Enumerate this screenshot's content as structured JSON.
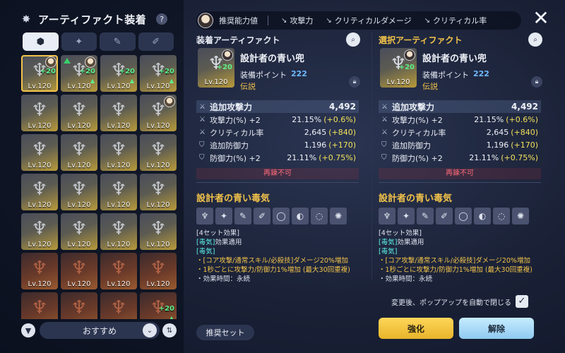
{
  "header": {
    "title": "アーティファクト装着",
    "help": "?"
  },
  "category_tabs": [
    {
      "icon": "artifact-icon",
      "glyph": "⬢"
    },
    {
      "icon": "armor-icon",
      "glyph": "✦"
    },
    {
      "icon": "weapon-icon",
      "glyph": "✎"
    },
    {
      "icon": "tool-icon",
      "glyph": "✐"
    }
  ],
  "inventory": [
    {
      "lv": "Lv.120",
      "tint": "gold",
      "plus": "+20",
      "selected": true,
      "avatar": true,
      "up": false,
      "green_arrow": false
    },
    {
      "lv": "Lv.120",
      "tint": "gold",
      "plus": "+20",
      "selected": false,
      "avatar": true,
      "up": true,
      "green_arrow": true
    },
    {
      "lv": "Lv.120",
      "tint": "gold",
      "plus": "+20",
      "selected": false,
      "avatar": false,
      "up": true,
      "green_arrow": false
    },
    {
      "lv": "Lv.120",
      "tint": "gold",
      "plus": "+20",
      "selected": false,
      "avatar": false,
      "up": true,
      "green_arrow": false
    },
    {
      "lv": "Lv.120",
      "tint": "gold",
      "plus": "",
      "selected": false,
      "avatar": false,
      "up": false,
      "green_arrow": false
    },
    {
      "lv": "Lv.120",
      "tint": "gold",
      "plus": "",
      "selected": false,
      "avatar": false,
      "up": false,
      "green_arrow": false
    },
    {
      "lv": "Lv.120",
      "tint": "gold",
      "plus": "",
      "selected": false,
      "avatar": false,
      "up": false,
      "green_arrow": false
    },
    {
      "lv": "Lv.120",
      "tint": "gold",
      "plus": "",
      "selected": false,
      "avatar": true,
      "up": false,
      "green_arrow": false
    },
    {
      "lv": "Lv.120",
      "tint": "gold",
      "plus": "",
      "selected": false,
      "avatar": false,
      "up": false,
      "green_arrow": false
    },
    {
      "lv": "Lv.120",
      "tint": "gold",
      "plus": "",
      "selected": false,
      "avatar": false,
      "up": false,
      "green_arrow": false
    },
    {
      "lv": "Lv.120",
      "tint": "gold",
      "plus": "",
      "selected": false,
      "avatar": false,
      "up": false,
      "green_arrow": false
    },
    {
      "lv": "Lv.120",
      "tint": "gold",
      "plus": "",
      "selected": false,
      "avatar": false,
      "up": false,
      "green_arrow": false
    },
    {
      "lv": "Lv.120",
      "tint": "gold",
      "plus": "",
      "selected": false,
      "avatar": false,
      "up": false,
      "green_arrow": false
    },
    {
      "lv": "Lv.120",
      "tint": "gold",
      "plus": "",
      "selected": false,
      "avatar": false,
      "up": false,
      "green_arrow": false
    },
    {
      "lv": "Lv.120",
      "tint": "gold",
      "plus": "",
      "selected": false,
      "avatar": false,
      "up": false,
      "green_arrow": false
    },
    {
      "lv": "Lv.120",
      "tint": "gold",
      "plus": "",
      "selected": false,
      "avatar": false,
      "up": false,
      "green_arrow": false
    },
    {
      "lv": "Lv.120",
      "tint": "gold",
      "plus": "",
      "selected": false,
      "avatar": false,
      "up": false,
      "green_arrow": false
    },
    {
      "lv": "Lv.120",
      "tint": "gold",
      "plus": "",
      "selected": false,
      "avatar": false,
      "up": false,
      "green_arrow": false
    },
    {
      "lv": "Lv.120",
      "tint": "gold",
      "plus": "",
      "selected": false,
      "avatar": false,
      "up": false,
      "green_arrow": false
    },
    {
      "lv": "Lv.120",
      "tint": "gold",
      "plus": "",
      "selected": false,
      "avatar": false,
      "up": false,
      "green_arrow": false
    },
    {
      "lv": "Lv.120",
      "tint": "red",
      "plus": "",
      "selected": false,
      "avatar": false,
      "up": false,
      "green_arrow": false
    },
    {
      "lv": "Lv.120",
      "tint": "red",
      "plus": "",
      "selected": false,
      "avatar": false,
      "up": false,
      "green_arrow": false
    },
    {
      "lv": "Lv.120",
      "tint": "red",
      "plus": "",
      "selected": false,
      "avatar": false,
      "up": false,
      "green_arrow": false
    },
    {
      "lv": "Lv.120",
      "tint": "red",
      "plus": "",
      "selected": false,
      "avatar": false,
      "up": false,
      "green_arrow": false
    },
    {
      "lv": "Lv.120",
      "tint": "red",
      "plus": "",
      "selected": false,
      "avatar": false,
      "up": false,
      "green_arrow": false
    },
    {
      "lv": "Lv.120",
      "tint": "red",
      "plus": "",
      "selected": false,
      "avatar": false,
      "up": false,
      "green_arrow": false
    },
    {
      "lv": "Lv.120",
      "tint": "red",
      "plus": "",
      "selected": false,
      "avatar": false,
      "up": false,
      "green_arrow": false
    },
    {
      "lv": "Lv.120",
      "tint": "red",
      "plus": "+20",
      "selected": false,
      "avatar": false,
      "up": true,
      "green_arrow": false
    },
    {
      "lv": "Lv.120",
      "tint": "red",
      "plus": "",
      "selected": false,
      "avatar": true,
      "up": false,
      "green_arrow": false
    },
    {
      "lv": "Lv.120",
      "tint": "red",
      "plus": "+20",
      "selected": false,
      "avatar": true,
      "up": false,
      "green_arrow": true
    },
    {
      "lv": "Lv.120",
      "tint": "red",
      "plus": "",
      "selected": false,
      "avatar": true,
      "up": false,
      "green_arrow": false
    },
    {
      "lv": "Lv.120",
      "tint": "red",
      "plus": "",
      "selected": false,
      "avatar": true,
      "up": false,
      "green_arrow": false
    }
  ],
  "sort": {
    "label": "おすすめ"
  },
  "topbar": {
    "recommended": "推奨能力値",
    "stats": [
      "攻撃力",
      "クリティカルダメージ",
      "クリティカル率"
    ]
  },
  "equipped": {
    "panel_title": "装着アーティファクト",
    "name": "設計者の青い兜",
    "points_label": "装備ポイント",
    "points": "222",
    "grade": "伝説",
    "lv": "Lv.120",
    "plus": "+20",
    "main_stat": {
      "label": "追加攻撃力",
      "value": "4,492"
    },
    "sub_stats": [
      {
        "label": "攻撃力(%) +2",
        "value": "21.15%",
        "bonus": "(+0.6%)"
      },
      {
        "label": "クリティカル率",
        "value": "2,645",
        "bonus": "(+840)"
      },
      {
        "label": "追加防御力",
        "value": "1,196",
        "bonus": "(+170)"
      },
      {
        "label": "防御力(%) +2",
        "value": "21.11%",
        "bonus": "(+0.75%)"
      }
    ],
    "no_refine": "再錬不可",
    "set_title": "設計者の青い毒気",
    "set_desc": {
      "head": "[4セット効果]",
      "applied": "[毒気]",
      "applied_suffix": "効果適用",
      "effect_name": "[毒気]",
      "line1": "・[コア攻撃/通常スキル/必殺技]ダメージ20%増加",
      "line2": "・1秒ごとに攻撃力/防御力1%増加 (最大30回重複)",
      "line3": "・効果時間：永続"
    }
  },
  "selected": {
    "panel_title": "選択アーティファクト",
    "name": "設計者の青い兜",
    "points_label": "装備ポイント",
    "points": "222",
    "grade": "伝説",
    "lv": "Lv.120",
    "plus": "+20",
    "main_stat": {
      "label": "追加攻撃力",
      "value": "4,492"
    },
    "sub_stats": [
      {
        "label": "攻撃力(%) +2",
        "value": "21.15%",
        "bonus": "(+0.6%)"
      },
      {
        "label": "クリティカル率",
        "value": "2,645",
        "bonus": "(+840)"
      },
      {
        "label": "追加防御力",
        "value": "1,196",
        "bonus": "(+170)"
      },
      {
        "label": "防御力(%) +2",
        "value": "21.11%",
        "bonus": "(+0.75%)"
      }
    ],
    "no_refine": "再錬不可",
    "set_title": "設計者の青い毒気",
    "set_desc": {
      "head": "[4セット効果]",
      "applied": "[毒気]",
      "applied_suffix": "効果適用",
      "effect_name": "[毒気]",
      "line1": "・[コア攻撃/通常スキル/必殺技]ダメージ20%増加",
      "line2": "・1秒ごとに攻撃力/防御力1%増加 (最大30回重複)",
      "line3": "・効果時間：永続"
    }
  },
  "bottom": {
    "auto_close": "変更後、ポップアップを自動で閉じる",
    "auto_close_checked": true,
    "recommended_set": "推奨セット",
    "enhance": "強化",
    "release": "解除"
  },
  "colors": {
    "gold": "#f2c34a",
    "bonus": "#f2e25a",
    "points": "#6fb8ff",
    "warn": "#ff6a78"
  }
}
